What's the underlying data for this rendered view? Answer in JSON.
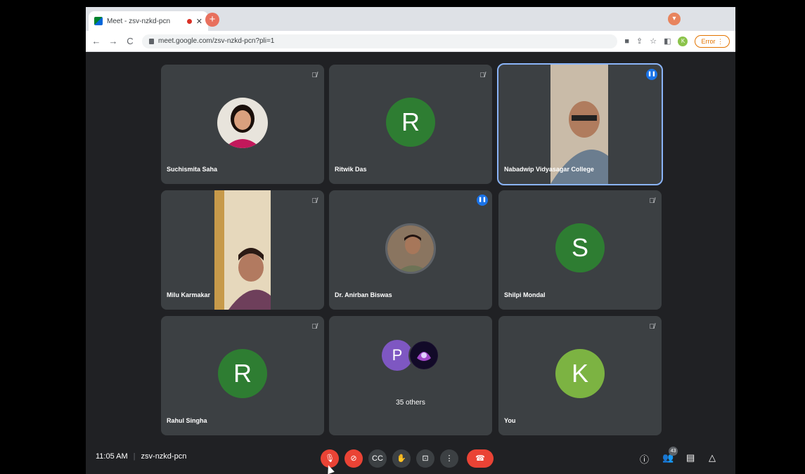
{
  "browser": {
    "tab_title": "Meet - zsv-nzkd-pcn",
    "url": "meet.google.com/zsv-nzkd-pcn?pli=1",
    "profile_letter": "K",
    "error_label": "Error"
  },
  "tiles": [
    {
      "name": "Suchismita Saha",
      "type": "photo"
    },
    {
      "name": "Ritwik Das",
      "type": "letter",
      "letter": "R",
      "color": "#2e7d32"
    },
    {
      "name": "Nabadwip Vidyasagar College",
      "type": "video",
      "active": true
    },
    {
      "name": "Milu Karmakar",
      "type": "video"
    },
    {
      "name": "Dr. Anirban Biswas",
      "type": "photo"
    },
    {
      "name": "Shilpi Mondal",
      "type": "letter",
      "letter": "S",
      "color": "#2e7d32"
    },
    {
      "name": "Rahul Singha",
      "type": "letter",
      "letter": "R",
      "color": "#2e7d32"
    },
    {
      "name": "35 others",
      "type": "others",
      "letter": "P",
      "color": "#7e57c2"
    },
    {
      "name": "You",
      "type": "letter",
      "letter": "K",
      "color": "#7cb342"
    }
  ],
  "bottom": {
    "time": "11:05 AM",
    "meeting_code": "zsv-nzkd-pcn",
    "participants_count": "43"
  },
  "icons": {
    "mic_off": "mic-off-icon",
    "camera_off": "camera-off-icon",
    "captions": "captions-icon",
    "hand": "raise-hand-icon",
    "present": "present-icon",
    "more": "more-options-icon",
    "end": "end-call-icon",
    "info": "info-icon",
    "people": "people-icon",
    "chat": "chat-icon",
    "activities": "activities-icon"
  }
}
